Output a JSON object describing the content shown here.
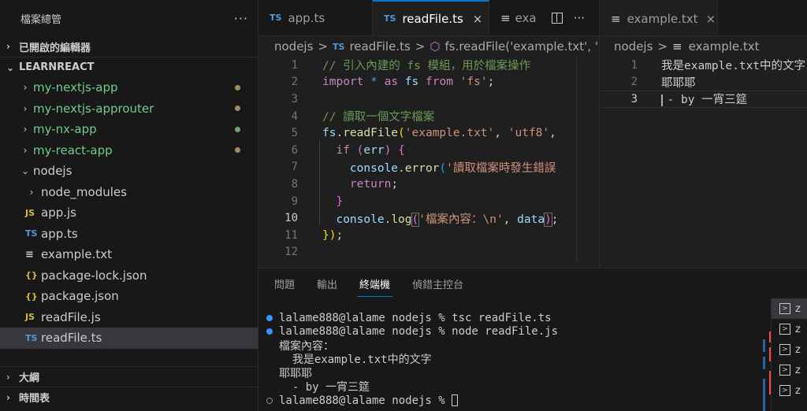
{
  "sidebar": {
    "title": "檔案總管",
    "more": "···",
    "open_editors": "已開啟的編輯器",
    "workspace": "LEARNREACT",
    "outline": "大綱",
    "timeline": "時間表",
    "items": [
      {
        "label": "my-nextjs-app",
        "kind": "folder"
      },
      {
        "label": "my-nextjs-approuter",
        "kind": "folder"
      },
      {
        "label": "my-nx-app",
        "kind": "folder"
      },
      {
        "label": "my-react-app",
        "kind": "folder"
      },
      {
        "label": "nodejs",
        "kind": "folder-open"
      },
      {
        "label": "node_modules",
        "kind": "folder"
      },
      {
        "label": "app.js",
        "icon": "JS"
      },
      {
        "label": "app.ts",
        "icon": "TS"
      },
      {
        "label": "example.txt",
        "icon": "≡"
      },
      {
        "label": "package-lock.json",
        "icon": "{}"
      },
      {
        "label": "package.json",
        "icon": "{}"
      },
      {
        "label": "readFile.js",
        "icon": "JS"
      },
      {
        "label": "readFile.ts",
        "icon": "TS"
      }
    ]
  },
  "editor1": {
    "tabs": [
      {
        "icon": "TS",
        "label": "app.ts"
      },
      {
        "icon": "TS",
        "label": "readFile.ts",
        "close": "×"
      },
      {
        "icon": "≡",
        "label": "exa"
      }
    ],
    "crumbs": [
      "nodejs",
      ">",
      "TS",
      "readFile.ts",
      ">",
      "fs.readFile('example.txt', 'ut"
    ],
    "line_numbers": [
      "1",
      "2",
      "3",
      "4",
      "5",
      "6",
      "7",
      "8",
      "9",
      "10",
      "11",
      "12"
    ]
  },
  "editor2": {
    "tab_label": "example.txt",
    "close": "×",
    "crumbs": [
      "nodejs",
      ">",
      "≡",
      "example.txt"
    ],
    "lines": [
      "我是example.txt中的文字",
      "耶耶耶",
      "- by 一宵三筵"
    ],
    "line_numbers": [
      "1",
      "2",
      "3"
    ]
  },
  "panel": {
    "tabs": [
      "問題",
      "輸出",
      "終端機",
      "偵錯主控台"
    ],
    "terminal": [
      "lalame888@lalame nodejs % tsc readFile.ts",
      "lalame888@lalame nodejs % node readFile.js",
      "檔案內容：",
      "  我是example.txt中的文字",
      "耶耶耶",
      "  - by 一宵三筵",
      "lalame888@lalame nodejs % "
    ],
    "side_terms": [
      "z",
      "z",
      "z",
      "z",
      "z"
    ]
  },
  "colors": {
    "accent": "#0078d4",
    "green_folder": "#73c991",
    "modified_dot": "#a08b62"
  }
}
